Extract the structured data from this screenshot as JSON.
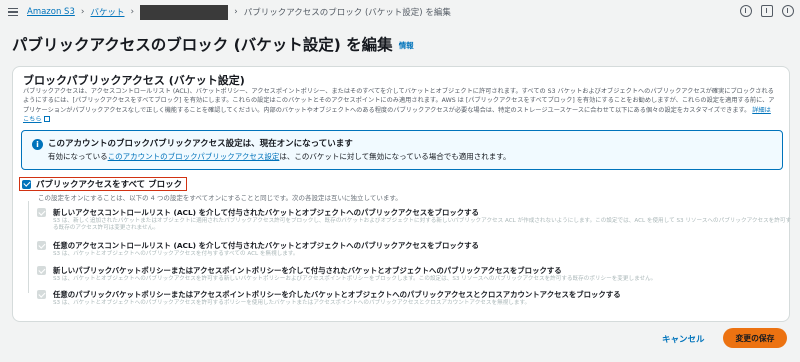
{
  "breadcrumb": {
    "items": [
      "Amazon S3",
      "バケット"
    ],
    "current": "パブリックアクセスのブロック (バケット設定) を編集"
  },
  "page": {
    "title": "パブリックアクセスのブロック (バケット設定) を編集",
    "info_label": "情報"
  },
  "panel": {
    "title": "ブロックパブリックアクセス (バケット設定)",
    "description": "パブリックアクセスは、アクセスコントロールリスト (ACL)、バケットポリシー、アクセスポイントポリシー、またはそのすべてを介してバケットとオブジェクトに許可されます。すべての S3 バケットおよびオブジェクトへのパブリックアクセスが確実にブロックされるようにするには、[パブリックアクセスをすべてブロック] を有効にします。これらの設定はこのバケットとそのアクセスポイントにのみ適用されます。AWS は [パブリックアクセスをすべてブロック] を有効にすることをお勧めしますが、これらの設定を適用する前に、アプリケーションがパブリックアクセスなしで正しく機能することを確認してください。内部のバケットやオブジェクトへのある程度のパブリックアクセスが必要な場合は、特定のストレージユースケースに合わせて以下にある個々の設定をカスタマイズできます。",
    "details_link": "詳細はこちら"
  },
  "alert": {
    "heading": "このアカウントのブロックパブリックアクセス設定は、現在オンになっています",
    "body_prefix": "有効になっている",
    "body_link": "このアカウントのブロックパブリックアクセス設定",
    "body_suffix": "は、このバケットに対して無効になっている場合でも適用されます。"
  },
  "master": {
    "label": "パブリックアクセスをすべて ブロック",
    "description": "この設定をオンにすることは、以下の 4 つの設定をすべてオンにすることと同じです。次の各設定は互いに独立しています。",
    "checked": true
  },
  "options": [
    {
      "label": "新しいアクセスコントロールリスト (ACL) を介して付与されたバケットとオブジェクトへのパブリックアクセスをブロックする",
      "description": "S3 は、新しく追加されたバケットまたはオブジェクトに適用されたパブリックアクセス許可をブロックし、既存のバケットおよびオブジェクトに対する新しいパブリックアクセス ACL が作成されないようにします。この設定では、ACL を使用して S3 リソースへのパブリックアクセスを許可する既存のアクセス許可は変更されません。"
    },
    {
      "label": "任意のアクセスコントロールリスト (ACL) を介して付与されたバケットとオブジェクトへのパブリックアクセスをブロックする",
      "description": "S3 は、バケットとオブジェクトへのパブリックアクセスを付与するすべての ACL を無視します。"
    },
    {
      "label": "新しいパブリックバケットポリシーまたはアクセスポイントポリシーを介して付与されたバケットとオブジェクトへのパブリックアクセスをブロックする",
      "description": "S3 は、バケットとオブジェクトへのパブリックアクセスを許可する新しいバケットポリシーおよびアクセスポイントポリシーをブロックします。この設定は、S3 リソースへのパブリックアクセスを許可する既存のポリシーを変更しません。"
    },
    {
      "label": "任意のパブリックバケットポリシーまたはアクセスポイントポリシーを介したバケットとオブジェクトへのパブリックアクセスとクロスアカウントアクセスをブロックする",
      "description": "S3 は、バケットとオブジェクトへのパブリックアクセスを許可するポリシーを使用したバケットまたはアクセスポイントへのパブリックアクセスとクロスアカウントアクセスを無視します。"
    }
  ],
  "actions": {
    "cancel": "キャンセル",
    "save": "変更の保存"
  },
  "colors": {
    "link": "#0073bb",
    "primary_button": "#ec7211",
    "highlight_border": "#d13212"
  }
}
